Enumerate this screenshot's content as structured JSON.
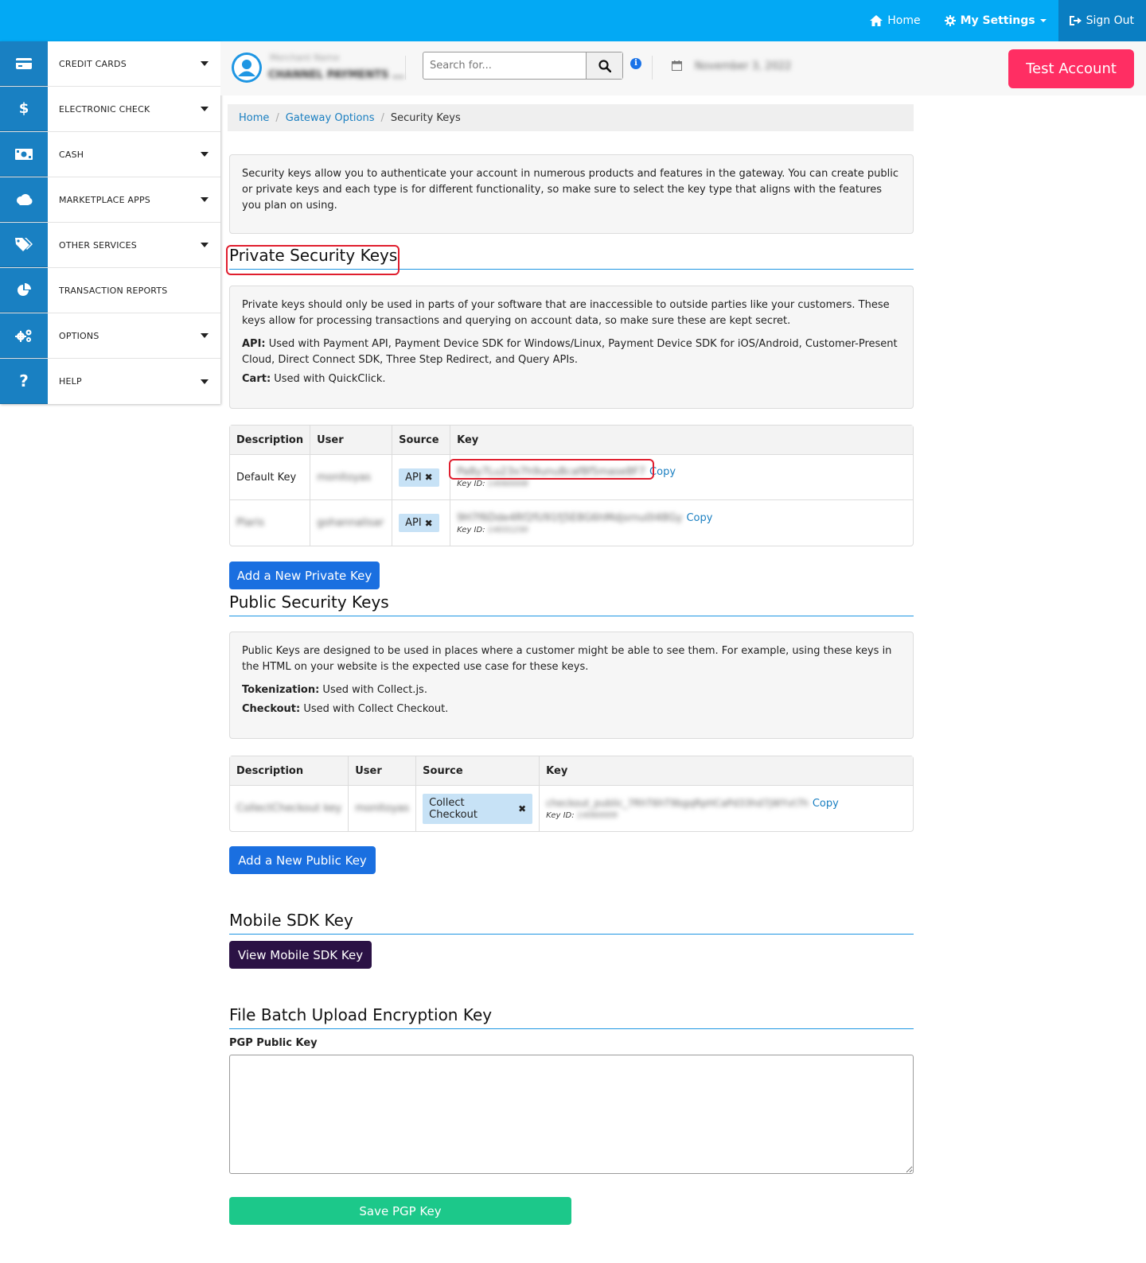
{
  "topnav": {
    "home": "Home",
    "settings": "My Settings",
    "signout": "Sign Out"
  },
  "sidebar": {
    "items": [
      {
        "label": "CREDIT CARDS",
        "icon": "credit-card-icon",
        "has_caret": true
      },
      {
        "label": "ELECTRONIC CHECK",
        "icon": "dollar-icon",
        "has_caret": true
      },
      {
        "label": "CASH",
        "icon": "money-icon",
        "has_caret": true
      },
      {
        "label": "MARKETPLACE APPS",
        "icon": "cloud-icon",
        "has_caret": true
      },
      {
        "label": "OTHER SERVICES",
        "icon": "tags-icon",
        "has_caret": true
      },
      {
        "label": "TRANSACTION REPORTS",
        "icon": "pie-chart-icon",
        "has_caret": false
      },
      {
        "label": "OPTIONS",
        "icon": "gears-icon",
        "has_caret": true
      },
      {
        "label": "HELP",
        "icon": "question-icon",
        "has_caret": true
      }
    ]
  },
  "header": {
    "merchant_name": "Merchant Name",
    "merchant_company": "CHANNEL PAYMENTS ...",
    "search_placeholder": "Search for...",
    "date": "November 3, 2022",
    "test_account": "Test Account"
  },
  "breadcrumb": {
    "home": "Home",
    "gateway_options": "Gateway Options",
    "current": "Security Keys"
  },
  "intro": "Security keys allow you to authenticate your account in numerous products and features in the gateway. You can create public or private keys and each type is for different functionality, so make sure to select the key type that aligns with the features you plan on using.",
  "private": {
    "title": "Private Security Keys",
    "desc": "Private keys should only be used in parts of your software that are inaccessible to outside parties like your customers. These keys allow for processing transactions and querying on account data, so make sure these are kept secret.",
    "api_label": "API:",
    "api_text": " Used with Payment API, Payment Device SDK for Windows/Linux, Payment Device SDK for iOS/Android, Customer-Present Cloud, Direct Connect SDK, Three Step Redirect, and Query APIs.",
    "cart_label": "Cart:",
    "cart_text": " Used with QuickClick.",
    "columns": [
      "Description",
      "User",
      "Source",
      "Key"
    ],
    "rows": [
      {
        "description": "Default Key",
        "user": "monitoyas",
        "source": "API",
        "key": "Pa8y7Lu23x7h9unu8caf8f5mase8F7",
        "copy": "Copy",
        "keyid_label": "Key ID:",
        "keyid": "14060008"
      },
      {
        "description": "Plaris",
        "user": "gohannalisar",
        "source": "API",
        "key": "9H7f6Dde4Rf2fU91fj5E8G6hMdjsrnu0l48Gy",
        "copy": "Copy",
        "keyid_label": "Key ID:",
        "keyid": "14031230"
      }
    ],
    "add_button": "Add a New Private Key"
  },
  "public": {
    "title": "Public Security Keys",
    "desc": "Public Keys are designed to be used in places where a customer might be able to see them. For example, using these keys in the HTML on your website is the expected use case for these keys.",
    "tok_label": "Tokenization:",
    "tok_text": " Used with Collect.js.",
    "checkout_label": "Checkout:",
    "checkout_text": " Used with Collect Checkout.",
    "columns": [
      "Description",
      "User",
      "Source",
      "Key"
    ],
    "rows": [
      {
        "description": "CollectCheckout key",
        "user": "monitoyas",
        "source": "Collect Checkout",
        "key": "checkout_public_7RhT6hT9bgqRpHCaPd33hd7jWYvt7h",
        "copy": "Copy",
        "keyid_label": "Key ID:",
        "keyid": "14060009"
      }
    ],
    "add_button": "Add a New Public Key"
  },
  "mobile": {
    "title": "Mobile SDK Key",
    "button": "View Mobile SDK Key"
  },
  "filebatch": {
    "title": "File Batch Upload Encryption Key",
    "label": "PGP Public Key",
    "value": "",
    "save_button": "Save PGP Key"
  },
  "colors": {
    "topbar": "#03a9f4",
    "sidebar_icon_bg": "#1980c2",
    "test_account": "#ff2e63",
    "primary_button": "#1a6fe0",
    "mobile_button": "#2b1245",
    "save_button": "#1cc88a",
    "highlight_box": "#e01e2e"
  }
}
